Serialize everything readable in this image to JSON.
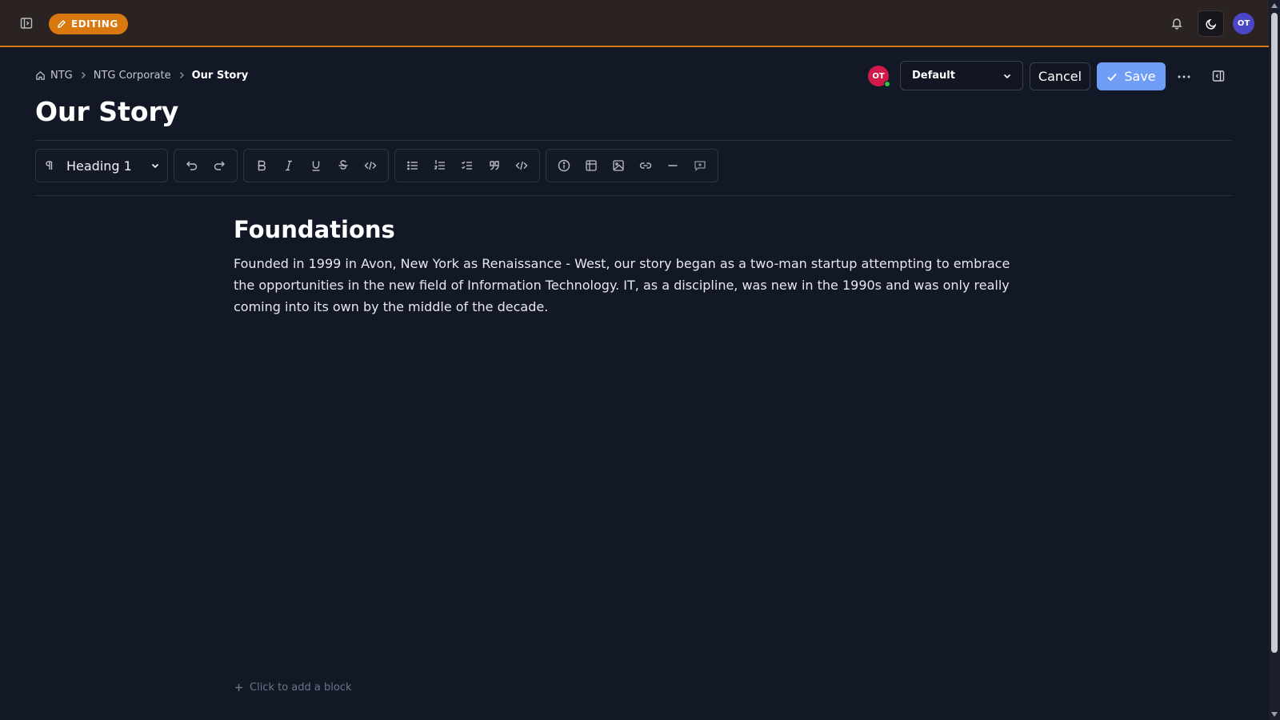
{
  "topbar": {
    "mode_badge": "EDITING",
    "avatar_initials": "OT",
    "icons": [
      "sidebar-toggle-icon",
      "pencil-icon",
      "bell-icon",
      "moon-icon"
    ]
  },
  "breadcrumb": {
    "items": [
      "NTG",
      "NTG Corporate",
      "Our Story"
    ]
  },
  "actions": {
    "presence_initials": "OT",
    "template_select": "Default",
    "cancel_label": "Cancel",
    "save_label": "Save"
  },
  "page": {
    "title": "Our Story"
  },
  "toolbar": {
    "block_type": "Heading 1",
    "groups": [
      [
        "undo-icon",
        "redo-icon"
      ],
      [
        "bold-icon",
        "italic-icon",
        "underline-icon",
        "strikethrough-icon",
        "inline-code-icon"
      ],
      [
        "bullet-list-icon",
        "numbered-list-icon",
        "task-list-icon",
        "quote-icon",
        "code-block-icon"
      ],
      [
        "info-callout-icon",
        "table-icon",
        "image-icon",
        "link-icon",
        "horizontal-rule-icon",
        "comment-icon"
      ]
    ]
  },
  "content": {
    "heading": "Foundations",
    "paragraph": "Founded in 1999 in Avon, New York as Renaissance - West, our story began as a two-man startup attempting to embrace the opportunities in the new field of Information Technology. IT, as a discipline, was new in the 1990s and was only really coming into its own by the middle of the decade.",
    "add_block": "Click to add a block"
  },
  "colors": {
    "background": "#131826",
    "topbar": "#2a2322",
    "accent_orange": "#d9780f",
    "save_blue": "#6f9cf5"
  }
}
